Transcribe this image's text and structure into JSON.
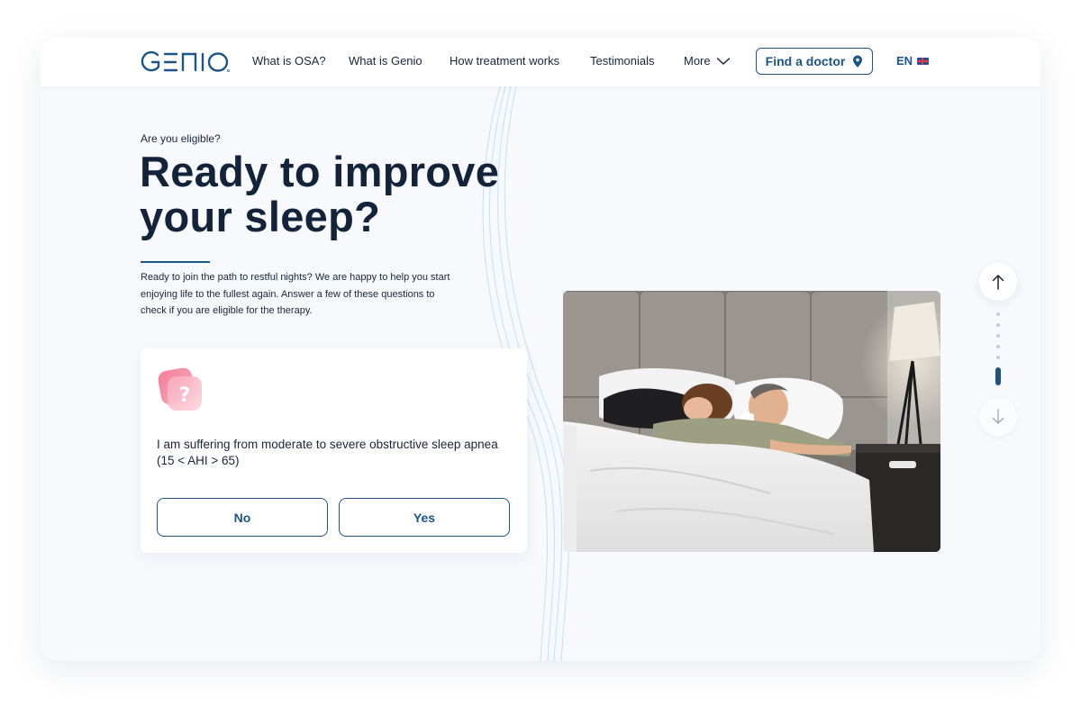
{
  "nav": {
    "logo": "GENIO",
    "items": [
      "What is OSA?",
      "What is Genio",
      "How treatment works",
      "Testimonials"
    ],
    "more_label": "More",
    "find_doctor_label": "Find a doctor",
    "language": "EN"
  },
  "hero": {
    "eyebrow": "Are you eligible?",
    "title": "Ready to improve your sleep?",
    "intro": "Ready to join the path to restful nights? We are happy to help you start enjoying life to the fullest again. Answer a few of these questions to check if you are eligible for the therapy."
  },
  "quiz": {
    "question": "I am suffering from moderate to severe obstructive sleep apnea",
    "condition": "(15 < AHI > 65)",
    "no_label": "No",
    "yes_label": "Yes"
  },
  "scroll_nav": {
    "section_count": 6,
    "active_index": 5
  },
  "colors": {
    "brand": "#1c5486",
    "heading": "#132339",
    "background": "#f7f9fc",
    "wave": "#bfe3f2",
    "quiz_icon": "#f28fa5"
  },
  "icons": {
    "location": "map-pin-icon",
    "chevron": "chevron-down-icon",
    "flag": "uk-flag-icon",
    "question": "question-icon",
    "up": "arrow-up-icon",
    "down": "arrow-down-icon"
  }
}
